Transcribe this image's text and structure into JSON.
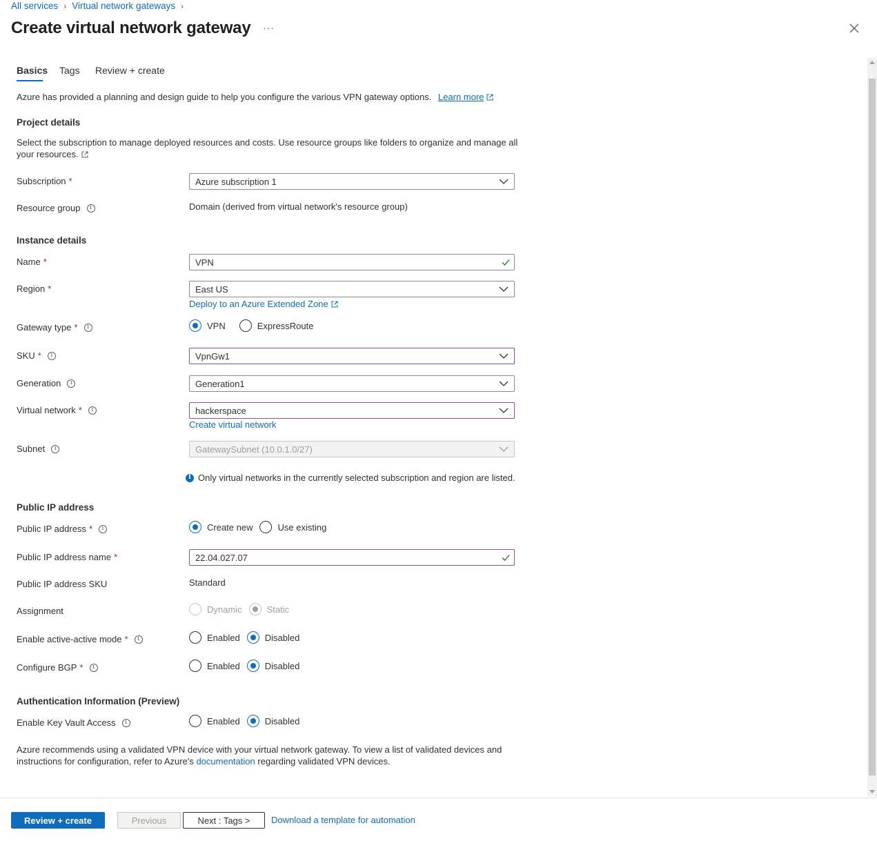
{
  "breadcrumb": {
    "items": [
      "All services",
      "Virtual network gateways"
    ]
  },
  "header": {
    "title": "Create virtual network gateway",
    "more": "···"
  },
  "tabs": [
    "Basics",
    "Tags",
    "Review + create"
  ],
  "intro": {
    "text": "Azure has provided a planning and design guide to help you configure the various VPN gateway options.",
    "link": "Learn more"
  },
  "project": {
    "heading": "Project details",
    "desc_line1": "Select the subscription to manage deployed resources and costs. Use resource groups like folders to organize and manage all",
    "desc_line2": "your resources.",
    "subscription_label": "Subscription",
    "subscription_value": "Azure subscription 1",
    "resource_group_label": "Resource group",
    "resource_group_value": "Domain (derived from virtual network's resource group)"
  },
  "instance": {
    "heading": "Instance details",
    "name_label": "Name",
    "name_value": "VPN",
    "region_label": "Region",
    "region_value": "East US",
    "region_link": "Deploy to an Azure Extended Zone",
    "gateway_type_label": "Gateway type",
    "gateway_type_options": [
      "VPN",
      "ExpressRoute"
    ],
    "sku_label": "SKU",
    "sku_value": "VpnGw1",
    "generation_label": "Generation",
    "generation_value": "Generation1",
    "vnet_label": "Virtual network",
    "vnet_value": "hackerspace",
    "vnet_link": "Create virtual network",
    "subnet_label": "Subnet",
    "subnet_value": "GatewaySubnet (10.0.1.0/27)",
    "vnet_note": "Only virtual networks in the currently selected subscription and region are listed."
  },
  "public_ip": {
    "heading": "Public IP address",
    "pip_label": "Public IP address",
    "pip_options": [
      "Create new",
      "Use existing"
    ],
    "pip_name_label": "Public IP address name",
    "pip_name_value": "22.04.027.07",
    "pip_sku_label": "Public IP address SKU",
    "pip_sku_value": "Standard",
    "assignment_label": "Assignment",
    "assignment_options": [
      "Dynamic",
      "Static"
    ],
    "active_label": "Enable active-active mode",
    "active_options": [
      "Enabled",
      "Disabled"
    ],
    "bgp_label": "Configure BGP",
    "bgp_options": [
      "Enabled",
      "Disabled"
    ]
  },
  "auth": {
    "heading": "Authentication Information (Preview)",
    "kv_label": "Enable Key Vault Access",
    "kv_options": [
      "Enabled",
      "Disabled"
    ]
  },
  "note": {
    "line1": "Azure recommends using a validated VPN device with your virtual network gateway. To view a list of validated devices and",
    "line2_pre": "instructions for configuration, refer to Azure's",
    "line2_link": "documentation",
    "line2_post": "regarding validated VPN devices."
  },
  "footer": {
    "review_create": "Review + create",
    "previous": "Previous",
    "next": "Next : Tags >",
    "template_link": "Download a template for automation"
  },
  "colors": {
    "accent": "#0f6cbd",
    "required": "#a4262c",
    "focus_border": "#8a4ea8",
    "valid_check": "#107c10"
  }
}
